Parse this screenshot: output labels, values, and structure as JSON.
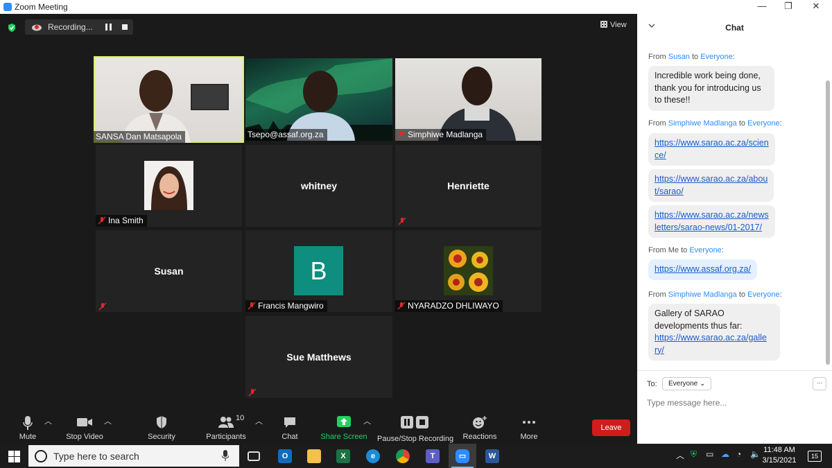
{
  "window": {
    "title": "Zoom Meeting",
    "min": "—",
    "max": "❐",
    "close": "✕"
  },
  "recording": {
    "label": "Recording..."
  },
  "view": {
    "label": "View"
  },
  "tiles": [
    {
      "name": "SANSA Dan Matsapola",
      "kind": "video"
    },
    {
      "name": "Tsepo@assaf.org.za",
      "kind": "video"
    },
    {
      "name": "Simphiwe Madlanga",
      "kind": "video"
    },
    {
      "name": "Ina Smith",
      "kind": "photo"
    },
    {
      "name": "whitney",
      "kind": "text"
    },
    {
      "name": "Henriette",
      "kind": "text"
    },
    {
      "name": "Susan",
      "kind": "text"
    },
    {
      "name": "Francis Mangwiro",
      "kind": "initial",
      "initial": "B"
    },
    {
      "name": "NYARADZO DHLIWAYO",
      "kind": "flower"
    },
    {
      "name": "Sue Matthews",
      "kind": "text"
    }
  ],
  "toolbar": {
    "mute": "Mute",
    "stop_video": "Stop Video",
    "security": "Security",
    "participants": "Participants",
    "participants_count": "10",
    "chat": "Chat",
    "share_screen": "Share Screen",
    "pause_stop_recording": "Pause/Stop Recording",
    "reactions": "Reactions",
    "more": "More",
    "leave": "Leave"
  },
  "chat": {
    "title": "Chat",
    "messages": [
      {
        "from": "Susan",
        "to": "Everyone",
        "text": "Incredible work being done, thank you for introducing us to these!!"
      },
      {
        "from": "Simphiwe Madlanga",
        "to": "Everyone",
        "links": [
          "https://www.sarao.ac.za/science/",
          "https://www.sarao.ac.za/about/sarao/",
          "https://www.sarao.ac.za/newsletters/sarao-news/01-2017/"
        ]
      },
      {
        "from": "Me",
        "to": "Everyone",
        "links": [
          "https://www.assaf.org.za/"
        ]
      },
      {
        "from": "Simphiwe Madlanga",
        "to": "Everyone",
        "text": "Gallery of SARAO developments thus far:",
        "links": [
          "https://www.sarao.ac.za/gallery/"
        ]
      }
    ],
    "display": {
      "l0a": "https://www.sarao.ac.za/scien",
      "l0b": "ce/",
      "l1a": "https://www.sarao.ac.za/abou",
      "l1b": "t/sarao/",
      "l2a": "https://www.sarao.ac.za/news",
      "l2b": "letters/sarao-news/01-2017/",
      "l3": "https://www.assaf.org.za/",
      "l4a": "https://www.sarao.ac.za/galle",
      "l4b": "ry/"
    },
    "from_word": "From",
    "to_word": "to",
    "to_label": "To:",
    "to_value": "Everyone",
    "placeholder": "Type message here..."
  },
  "taskbar": {
    "search_placeholder": "Type here to search",
    "time": "11:48 AM",
    "date": "3/15/2021",
    "notifications": "15"
  }
}
